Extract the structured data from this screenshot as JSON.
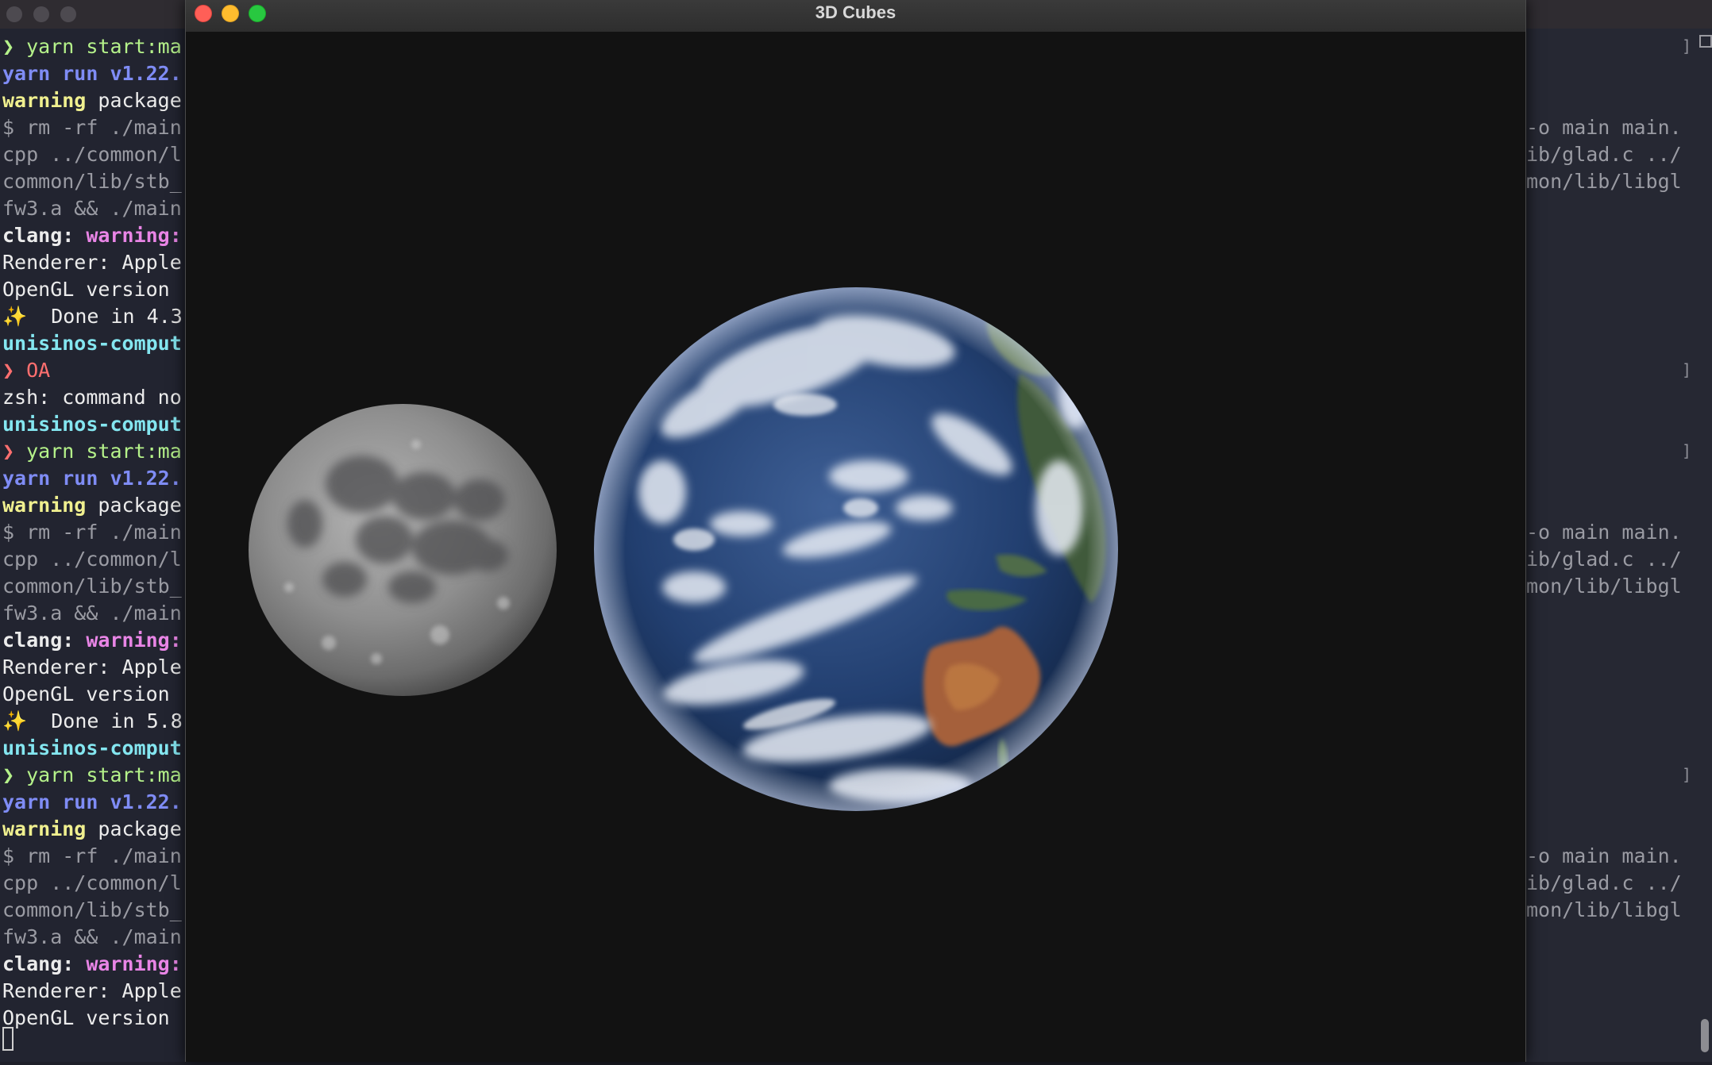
{
  "terminal": {
    "left_lines": [
      {
        "segments": [
          {
            "text": "❯ ",
            "cls": "c-green"
          },
          {
            "text": "yarn start:ma",
            "cls": "c-green"
          }
        ]
      },
      {
        "segments": [
          {
            "text": "yarn run v1.22.",
            "cls": "c-blue"
          }
        ]
      },
      {
        "segments": [
          {
            "text": "warning",
            "cls": "c-yellow"
          },
          {
            "text": " package",
            "cls": "c-white"
          }
        ]
      },
      {
        "segments": [
          {
            "text": "$ rm -rf ./main",
            "cls": "c-gray"
          }
        ]
      },
      {
        "segments": [
          {
            "text": "cpp ../common/l",
            "cls": "c-gray"
          }
        ]
      },
      {
        "segments": [
          {
            "text": "common/lib/stb_",
            "cls": "c-gray"
          }
        ]
      },
      {
        "segments": [
          {
            "text": "fw3.a && ./main",
            "cls": "c-gray"
          }
        ]
      },
      {
        "segments": [
          {
            "text": "clang: ",
            "cls": "c-white c-bold"
          },
          {
            "text": "warning:",
            "cls": "c-pink"
          }
        ]
      },
      {
        "segments": [
          {
            "text": "Renderer: Apple",
            "cls": "c-white"
          }
        ]
      },
      {
        "segments": [
          {
            "text": "OpenGL version ",
            "cls": "c-white"
          }
        ]
      },
      {
        "segments": [
          {
            "text": "✨  Done in 4.3",
            "cls": "c-white"
          }
        ]
      },
      {
        "segments": [
          {
            "text": "unisinos-comput",
            "cls": "c-cyan"
          }
        ]
      },
      {
        "segments": [
          {
            "text": "❯ ",
            "cls": "c-red"
          },
          {
            "text": "OA",
            "cls": "c-red"
          }
        ]
      },
      {
        "segments": [
          {
            "text": "zsh: command no",
            "cls": "c-white"
          }
        ]
      },
      {
        "segments": [
          {
            "text": "unisinos-comput",
            "cls": "c-cyan"
          }
        ]
      },
      {
        "segments": [
          {
            "text": "❯ ",
            "cls": "c-red"
          },
          {
            "text": "yarn start:ma",
            "cls": "c-green"
          }
        ]
      },
      {
        "segments": [
          {
            "text": "yarn run v1.22.",
            "cls": "c-blue"
          }
        ]
      },
      {
        "segments": [
          {
            "text": "warning",
            "cls": "c-yellow"
          },
          {
            "text": " package",
            "cls": "c-white"
          }
        ]
      },
      {
        "segments": [
          {
            "text": "$ rm -rf ./main",
            "cls": "c-gray"
          }
        ]
      },
      {
        "segments": [
          {
            "text": "cpp ../common/l",
            "cls": "c-gray"
          }
        ]
      },
      {
        "segments": [
          {
            "text": "common/lib/stb_",
            "cls": "c-gray"
          }
        ]
      },
      {
        "segments": [
          {
            "text": "fw3.a && ./main",
            "cls": "c-gray"
          }
        ]
      },
      {
        "segments": [
          {
            "text": "clang: ",
            "cls": "c-white c-bold"
          },
          {
            "text": "warning:",
            "cls": "c-pink"
          }
        ]
      },
      {
        "segments": [
          {
            "text": "Renderer: Apple",
            "cls": "c-white"
          }
        ]
      },
      {
        "segments": [
          {
            "text": "OpenGL version ",
            "cls": "c-white"
          }
        ]
      },
      {
        "segments": [
          {
            "text": "✨  Done in 5.8",
            "cls": "c-white"
          }
        ]
      },
      {
        "segments": [
          {
            "text": "unisinos-comput",
            "cls": "c-cyan"
          }
        ]
      },
      {
        "segments": [
          {
            "text": "❯ ",
            "cls": "c-green"
          },
          {
            "text": "yarn start:ma",
            "cls": "c-green"
          }
        ]
      },
      {
        "segments": [
          {
            "text": "yarn run v1.22.",
            "cls": "c-blue"
          }
        ]
      },
      {
        "segments": [
          {
            "text": "warning",
            "cls": "c-yellow"
          },
          {
            "text": " package",
            "cls": "c-white"
          }
        ]
      },
      {
        "segments": [
          {
            "text": "$ rm -rf ./main",
            "cls": "c-gray"
          }
        ]
      },
      {
        "segments": [
          {
            "text": "cpp ../common/l",
            "cls": "c-gray"
          }
        ]
      },
      {
        "segments": [
          {
            "text": "common/lib/stb_",
            "cls": "c-gray"
          }
        ]
      },
      {
        "segments": [
          {
            "text": "fw3.a && ./main",
            "cls": "c-gray"
          }
        ]
      },
      {
        "segments": [
          {
            "text": "clang: ",
            "cls": "c-white c-bold"
          },
          {
            "text": "warning:",
            "cls": "c-pink"
          }
        ]
      },
      {
        "segments": [
          {
            "text": "Renderer: Apple",
            "cls": "c-white"
          }
        ]
      },
      {
        "segments": [
          {
            "text": "OpenGL version ",
            "cls": "c-white"
          }
        ]
      }
    ],
    "right_lines": [
      {
        "line_index": 3,
        "text": "-o main main."
      },
      {
        "line_index": 4,
        "text": "ib/glad.c ../"
      },
      {
        "line_index": 5,
        "text": "mon/lib/libgl"
      },
      {
        "line_index": 18,
        "text": "-o main main."
      },
      {
        "line_index": 19,
        "text": "ib/glad.c ../"
      },
      {
        "line_index": 20,
        "text": "mon/lib/libgl"
      },
      {
        "line_index": 30,
        "text": "-o main main."
      },
      {
        "line_index": 31,
        "text": "ib/glad.c ../"
      },
      {
        "line_index": 32,
        "text": "mon/lib/libgl"
      }
    ],
    "bracket_glyph": "]",
    "bracket_line_indices": [
      0,
      12,
      15,
      27
    ]
  },
  "gl_window": {
    "title": "3D Cubes",
    "traffic_lights": {
      "close": "#ff5f57",
      "minimize": "#febc2e",
      "maximize": "#28c840"
    },
    "scene": {
      "objects": [
        {
          "name": "moon",
          "kind": "textured-sphere"
        },
        {
          "name": "earth",
          "kind": "textured-sphere"
        }
      ],
      "background": "#121212"
    }
  }
}
